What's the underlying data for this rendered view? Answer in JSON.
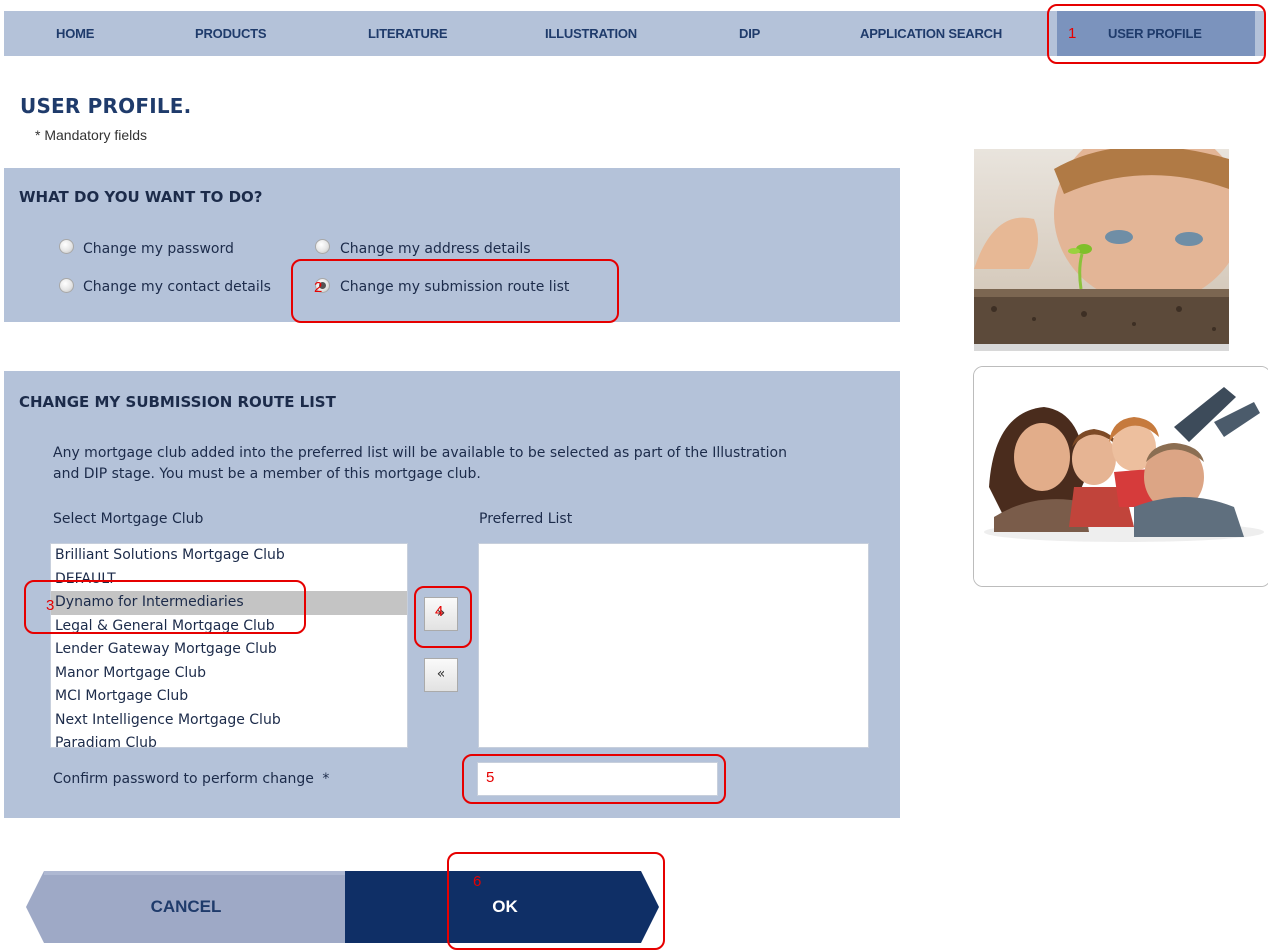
{
  "nav": {
    "items": [
      "HOME",
      "PRODUCTS",
      "LITERATURE",
      "ILLUSTRATION",
      "DIP",
      "APPLICATION SEARCH",
      "USER PROFILE"
    ],
    "active": "USER PROFILE"
  },
  "page": {
    "title": "USER PROFILE.",
    "mandatory_note": "* Mandatory fields"
  },
  "what_to_do": {
    "title": "WHAT DO YOU WANT TO DO?",
    "options": [
      "Change my password",
      "Change my address details",
      "Change my contact details",
      "Change my submission route list"
    ],
    "selected": "Change my submission route list"
  },
  "route_list": {
    "title": "CHANGE MY SUBMISSION ROUTE LIST",
    "description_line1": "Any mortgage club added into the preferred list will be available to be selected as part of the Illustration",
    "description_line2": "and DIP stage. You must be a member of this mortgage club.",
    "select_label": "Select Mortgage Club",
    "preferred_label": "Preferred List",
    "clubs": [
      "Brilliant Solutions Mortgage Club",
      "DEFAULT",
      "Dynamo for Intermediaries",
      "Legal & General Mortgage Club",
      "Lender Gateway Mortgage Club",
      "Manor Mortgage Club",
      "MCI Mortgage Club",
      "Next Intelligence Mortgage Club",
      "Paradigm Club"
    ],
    "selected_club": "Dynamo for Intermediaries",
    "preferred": [],
    "add_label": "»",
    "remove_label": "«",
    "password_label": "Confirm password to perform change",
    "password_required_mark": "*",
    "password_value": ""
  },
  "buttons": {
    "cancel": "CANCEL",
    "ok": "OK"
  },
  "annotations": [
    "1",
    "2",
    "3",
    "4",
    "5",
    "6"
  ],
  "colors": {
    "nav_bg": "#b4c2d9",
    "nav_active": "#7b93bd",
    "panel_bg": "#b4c2d9",
    "ok_bg": "#0f2f66",
    "cancel_bg": "#9ea9c6",
    "annotation": "#e60000"
  },
  "images": [
    "boy-with-seedling-photo",
    "family-lying-down-photo"
  ]
}
